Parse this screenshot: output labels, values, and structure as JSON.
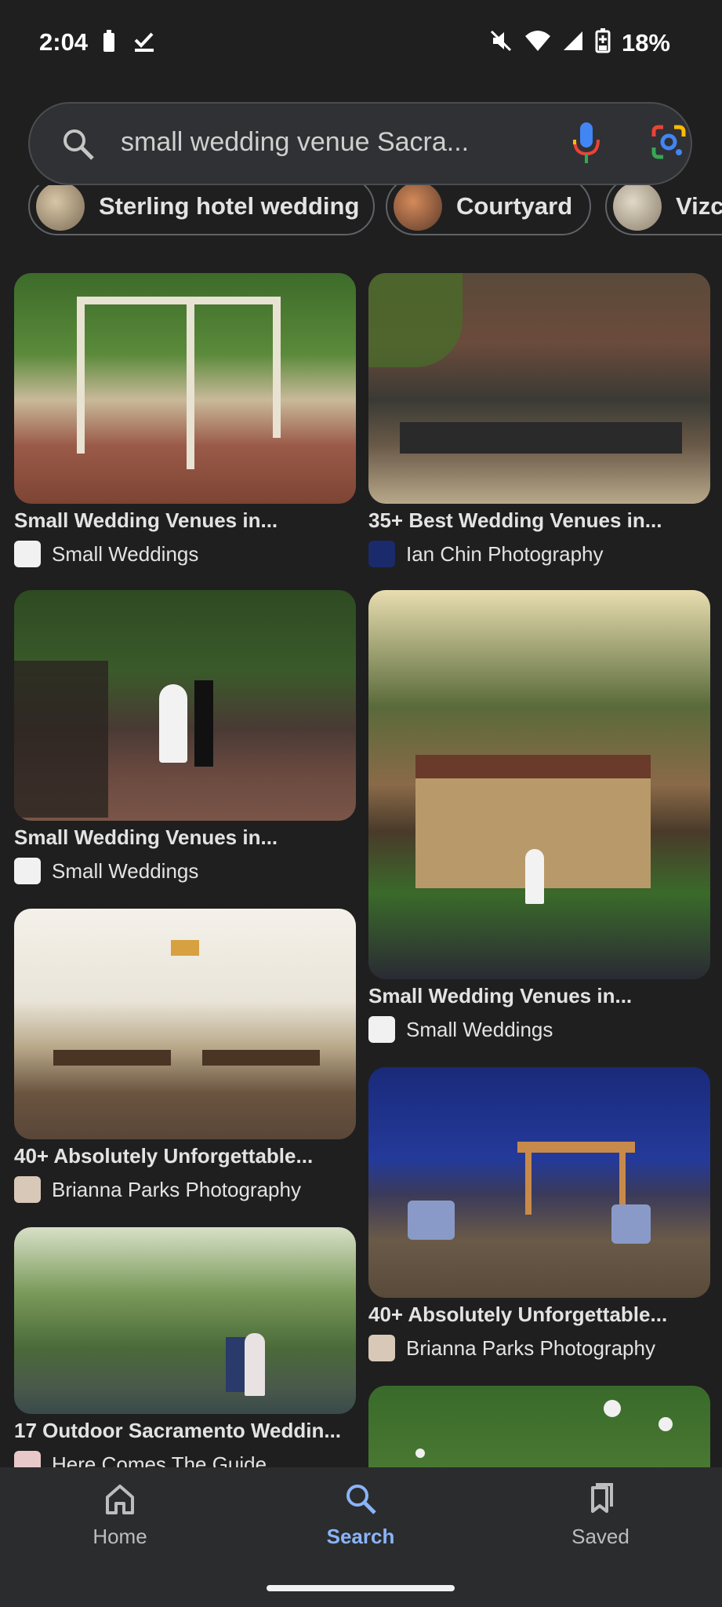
{
  "status_bar": {
    "time": "2:04",
    "battery": "18%"
  },
  "search": {
    "query": "small wedding venue Sacra..."
  },
  "chips": [
    {
      "label": "Sterling hotel wedding"
    },
    {
      "label": "Courtyard"
    },
    {
      "label": "Vizca"
    }
  ],
  "results": [
    {
      "title": "Small Wedding Venues in...",
      "source": "Small Weddings"
    },
    {
      "title": "35+ Best Wedding Venues in...",
      "source": "Ian Chin Photography"
    },
    {
      "title": "Small Wedding Venues in...",
      "source": "Small Weddings"
    },
    {
      "title": "Small Wedding Venues in...",
      "source": "Small Weddings"
    },
    {
      "title": "40+ Absolutely Unforgettable...",
      "source": "Brianna Parks Photography"
    },
    {
      "title": "40+ Absolutely Unforgettable...",
      "source": "Brianna Parks Photography"
    },
    {
      "title": "17 Outdoor Sacramento Weddin...",
      "source": "Here Comes The Guide"
    },
    {
      "title": "",
      "source": ""
    }
  ],
  "nav": {
    "home": "Home",
    "search": "Search",
    "saved": "Saved"
  },
  "colors": {
    "background": "#1f1f1f",
    "accent": "#8ab4f8",
    "nav_bg": "#2b2c2e"
  }
}
